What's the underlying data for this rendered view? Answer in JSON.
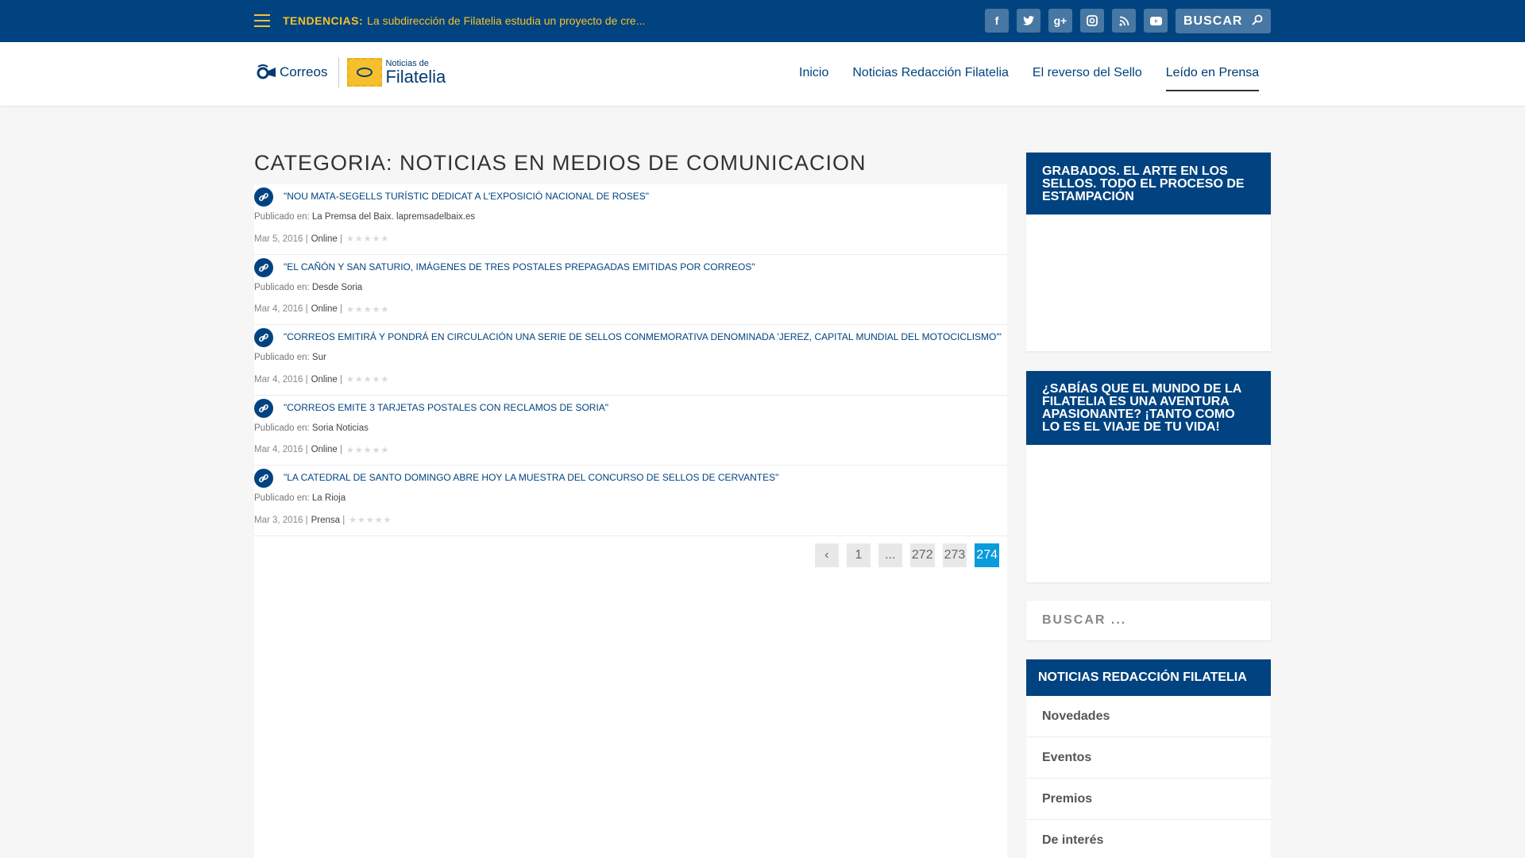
{
  "topbar": {
    "trend_label": "TENDENCIAS:",
    "trend_text": "La subdirección de Filatelia estudia un proyecto de cre...",
    "socials": [
      "facebook-icon",
      "twitter-icon",
      "google-plus-icon",
      "instagram-icon",
      "rss-icon",
      "youtube-icon"
    ],
    "search_label": "BUSCAR"
  },
  "header": {
    "logo_correos": "Correos",
    "logo_small": "Noticias de",
    "logo_big": "Filatelia",
    "nav": [
      "Inicio",
      "Noticias Redacción Filatelia",
      "El reverso del Sello",
      "Leído en Prensa"
    ],
    "active_nav": "Leído en Prensa"
  },
  "main": {
    "category_title": "CATEGORIA: NOTICIAS EN MEDIOS DE COMUNICACION",
    "published_label": "Publicado en:",
    "posts": [
      {
        "title": "\"NOU MATA-SEGELLS TURÍSTIC DEDICAT A L'EXPOSICIÓ NACIONAL DE ROSES\"",
        "source": "La Premsa del Baix. lapremsadelbaix.es",
        "date": "Mar 5, 2016",
        "cat": "Online"
      },
      {
        "title": "\"EL CAÑÓN Y SAN SATURIO, IMÁGENES DE TRES POSTALES PREPAGADAS EMITIDAS POR CORREOS\"",
        "source": "Desde Soria",
        "date": "Mar 4, 2016",
        "cat": "Online"
      },
      {
        "title": "\"CORREOS EMITIRÁ Y PONDRÁ EN CIRCULACIÓN UNA SERIE DE SELLOS CONMEMORATIVA DENOMINADA 'JEREZ, CAPITAL MUNDIAL DEL MOTOCICLISMO'\"",
        "source": "Sur",
        "date": "Mar 4, 2016",
        "cat": "Online"
      },
      {
        "title": "\"CORREOS EMITE 3 TARJETAS POSTALES CON RECLAMOS DE SORIA\"",
        "source": "Soria Noticias",
        "date": "Mar 4, 2016",
        "cat": "Online"
      },
      {
        "title": "\"LA CATEDRAL DE SANTO DOMINGO ABRE HOY LA MUESTRA DEL CONCURSO DE SELLOS DE CERVANTES\"",
        "source": "La Rioja",
        "date": "Mar 3, 2016",
        "cat": "Prensa"
      }
    ],
    "pagination": [
      "‹",
      "1",
      "...",
      "272",
      "273",
      "274"
    ],
    "current_page": "274"
  },
  "sidebar": {
    "widget1_title": "GRABADOS. EL ARTE EN LOS SELLOS. TODO EL PROCESO DE ESTAMPACIÓN",
    "widget2_title": "¿SABÍAS QUE EL MUNDO DE LA FILATELIA ES UNA AVENTURA APASIONANTE? ¡TANTO COMO LO ES EL VIAJE DE TU VIDA!",
    "search_placeholder": "BUSCAR ...",
    "list_title": "NOTICIAS REDACCIÓN FILATELIA",
    "list_items": [
      "Novedades",
      "Eventos",
      "Premios",
      "De interés"
    ]
  },
  "colors": {
    "brand_blue": "#004380",
    "accent_yellow": "#f5c02b",
    "page_active": "#0a9bdc"
  }
}
